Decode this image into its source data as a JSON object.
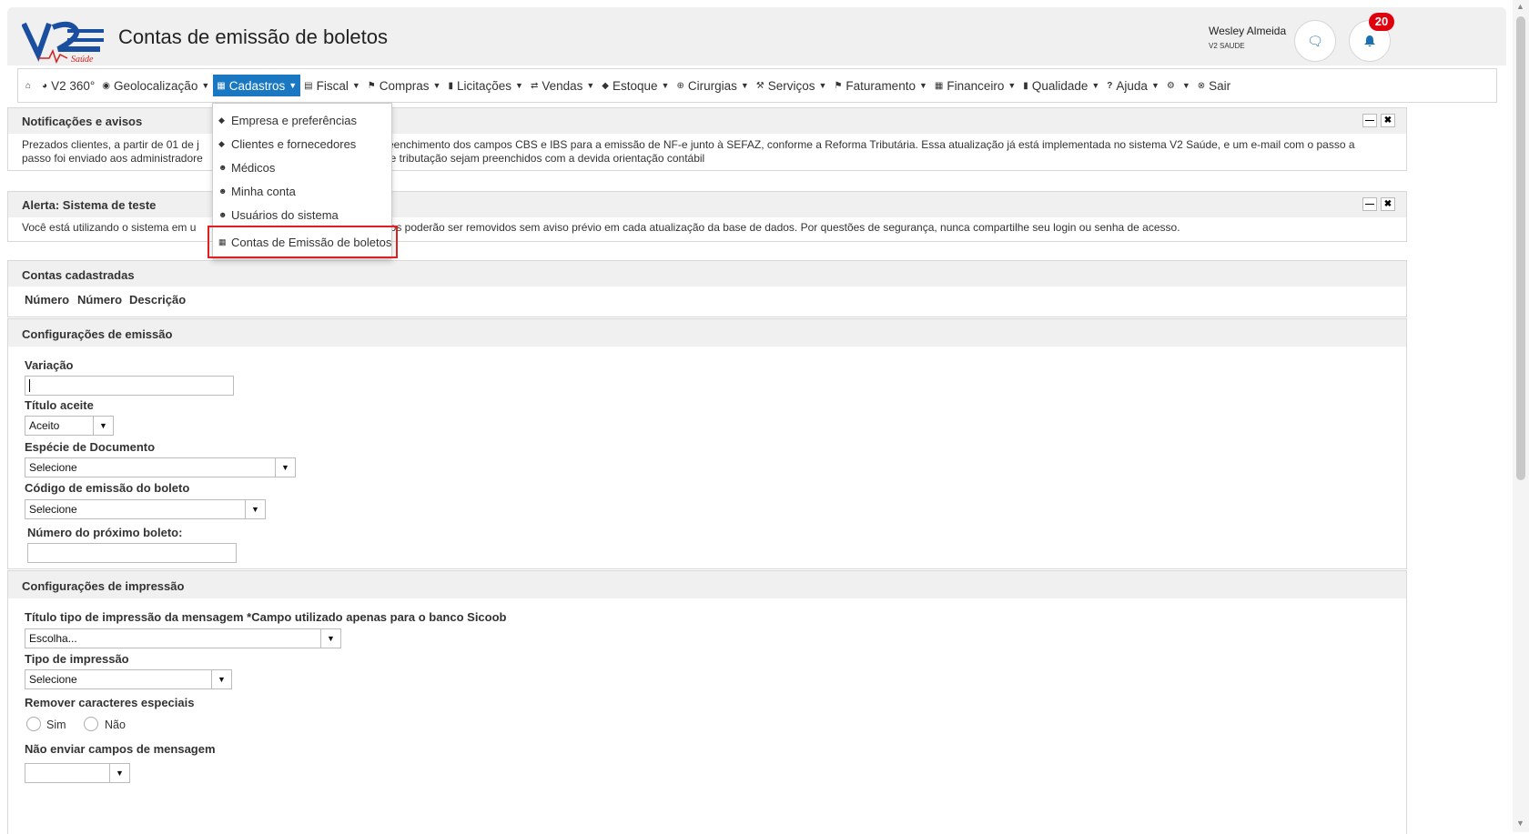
{
  "header": {
    "logo_text": "V2",
    "logo_sub": "Saúde",
    "title": "Contas de emissão de boletos",
    "user_name": "Wesley Almeida",
    "user_company": "V2 SAUDE",
    "notifications_count": "20"
  },
  "nav": {
    "items": [
      {
        "label": "",
        "icon": "home-icon"
      },
      {
        "label": "V2 360°",
        "icon": "pie-chart-icon"
      },
      {
        "label": "Geolocalização",
        "icon": "globe-icon",
        "caret": true
      },
      {
        "label": "Cadastros",
        "icon": "table-icon",
        "caret": true,
        "active": true
      },
      {
        "label": "Fiscal",
        "icon": "fiscal-icon",
        "caret": true
      },
      {
        "label": "Compras",
        "icon": "building-icon",
        "caret": true
      },
      {
        "label": "Licitações",
        "icon": "document-icon",
        "caret": true
      },
      {
        "label": "Vendas",
        "icon": "exchange-icon",
        "caret": true
      },
      {
        "label": "Estoque",
        "icon": "tag-icon",
        "caret": true
      },
      {
        "label": "Cirurgias",
        "icon": "plus-circle-icon",
        "caret": true
      },
      {
        "label": "Serviços",
        "icon": "wrench-icon",
        "caret": true
      },
      {
        "label": "Faturamento",
        "icon": "bank-icon",
        "caret": true
      },
      {
        "label": "Financeiro",
        "icon": "calculator-icon",
        "caret": true
      },
      {
        "label": "Qualidade",
        "icon": "clipboard-icon",
        "caret": true
      },
      {
        "label": "Ajuda",
        "icon": "question-icon",
        "caret": true
      },
      {
        "label": "",
        "icon": "gear-icon",
        "caret": true
      },
      {
        "label": "Sair",
        "icon": "close-circle-icon"
      }
    ]
  },
  "dropdown": {
    "items": [
      {
        "label": "Empresa e preferências",
        "icon": "tag-icon"
      },
      {
        "label": "Clientes e fornecedores",
        "icon": "tag-icon"
      },
      {
        "label": "Médicos",
        "icon": "user-icon"
      },
      {
        "label": "Minha conta",
        "icon": "user-icon"
      },
      {
        "label": "Usuários do sistema",
        "icon": "user-icon"
      },
      {
        "label": "Contas de Emissão de boletos",
        "icon": "table-icon"
      }
    ]
  },
  "notifications": {
    "title": "Notificações e avisos",
    "line1_left": "Prezados clientes, a partir de 01 de j",
    "line1_right": "reenchimento dos campos CBS e IBS para a emissão de NF-e junto à SEFAZ, conforme a Reforma Tributária. Essa atualização já está implementada no sistema V2 Saúde, e um e-mail com o passo a",
    "line2_left": "passo foi enviado aos administradore",
    "line2_right": "de tributação sejam preenchidos com a devida orientação contábil"
  },
  "alert": {
    "title": "Alerta: Sistema de teste",
    "text_left": "Você está utilizando o sistema em u",
    "text_right": "dos poderão ser removidos sem aviso prévio em cada atualização da base de dados. Por questões de segurança, nunca compartilhe seu login ou senha de acesso."
  },
  "accounts": {
    "title": "Contas cadastradas",
    "columns": [
      "Número",
      "Número",
      "Descrição"
    ]
  },
  "emission": {
    "title": "Configurações de emissão",
    "variacao_label": "Variação",
    "variacao_value": "",
    "titulo_aceite_label": "Título aceite",
    "titulo_aceite_value": "Aceito",
    "especie_label": "Espécie de Documento",
    "especie_value": "Selecione",
    "codigo_label": "Código de emissão do boleto",
    "codigo_value": "Selecione",
    "proximo_label": "Número do próximo boleto:",
    "proximo_value": ""
  },
  "printing": {
    "title": "Configurações de impressão",
    "titulo_tipo_label": "Título tipo de impressão da mensagem *Campo utilizado apenas para o banco Sicoob",
    "titulo_tipo_value": "Escolha...",
    "tipo_label": "Tipo de impressão",
    "tipo_value": "Selecione",
    "remover_label": "Remover caracteres especiais",
    "sim_label": "Sim",
    "nao_label": "Não",
    "nao_enviar_label": "Não enviar campos de mensagem",
    "nao_enviar_value": ""
  },
  "colors": {
    "accent": "#1a78c2",
    "badge": "#e0000d",
    "highlight_border": "#e02020",
    "panel_header": "#f0f0f0"
  }
}
